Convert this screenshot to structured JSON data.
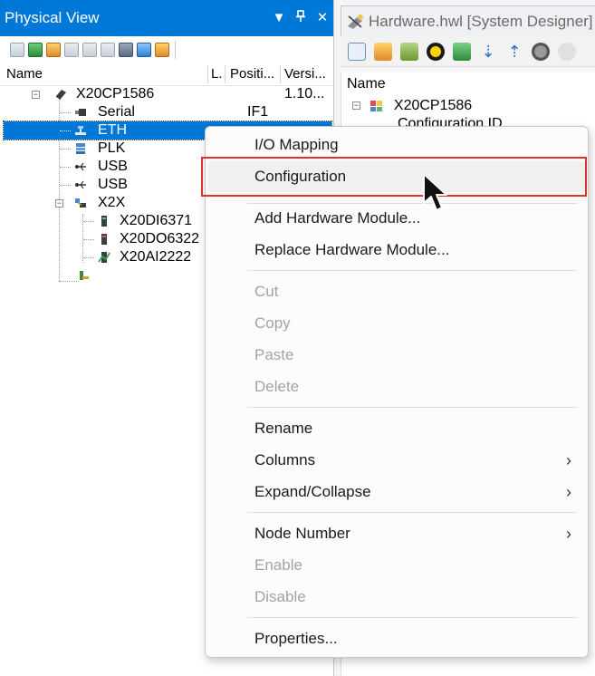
{
  "physical_view": {
    "title": "Physical View",
    "title_buttons": [
      {
        "icon": "dropdown-arrow-icon",
        "glyph": "▼"
      },
      {
        "icon": "pin-icon",
        "glyph": "⊥"
      },
      {
        "icon": "close-icon",
        "glyph": "✕"
      }
    ],
    "columns": {
      "name": "Name",
      "l": "L.",
      "position": "Positi...",
      "version": "Versi..."
    },
    "tree": [
      {
        "label": "X20CP1586",
        "icon": "cpu-icon",
        "version": "1.10...",
        "position": ""
      },
      {
        "label": "Serial",
        "icon": "serial-port-icon",
        "position": "IF1",
        "version": ""
      },
      {
        "label": "ETH",
        "icon": "ethernet-icon",
        "position": "",
        "version": "",
        "selected": true
      },
      {
        "label": "PLK",
        "icon": "powerlink-icon",
        "position": "",
        "version": ""
      },
      {
        "label": "USB",
        "icon": "usb-icon",
        "position": "",
        "version": ""
      },
      {
        "label": "USB",
        "icon": "usb-icon",
        "position": "",
        "version": ""
      },
      {
        "label": "X2X",
        "icon": "x2x-bus-icon",
        "position": "",
        "version": ""
      },
      {
        "label": "X20DI6371",
        "icon": "digital-input-module-icon",
        "position": "",
        "version": ""
      },
      {
        "label": "X20DO6322",
        "icon": "digital-output-module-icon",
        "position": "",
        "version": ""
      },
      {
        "label": "X20AI2222",
        "icon": "analog-input-module-icon",
        "position": "",
        "version": ""
      }
    ]
  },
  "hardware_tab": {
    "label": "Hardware.hwl [System Designer]",
    "icon": "hardware-config-icon",
    "header": "Name",
    "rows": [
      "X20CP1586",
      "Configuration ID"
    ]
  },
  "context_menu": {
    "items": [
      {
        "label": "I/O Mapping",
        "enabled": true
      },
      {
        "label": "Configuration",
        "enabled": true,
        "hovered": true
      },
      {
        "separator": true
      },
      {
        "label": "Add Hardware Module...",
        "enabled": true
      },
      {
        "label": "Replace Hardware Module...",
        "enabled": true
      },
      {
        "separator": true
      },
      {
        "label": "Cut",
        "enabled": false
      },
      {
        "label": "Copy",
        "enabled": false
      },
      {
        "label": "Paste",
        "enabled": false
      },
      {
        "label": "Delete",
        "enabled": false
      },
      {
        "separator": true
      },
      {
        "label": "Rename",
        "enabled": true
      },
      {
        "label": "Columns",
        "enabled": true,
        "submenu": true
      },
      {
        "label": "Expand/Collapse",
        "enabled": true,
        "submenu": true
      },
      {
        "separator": true
      },
      {
        "label": "Node Number",
        "enabled": true,
        "submenu": true
      },
      {
        "label": "Enable",
        "enabled": false
      },
      {
        "label": "Disable",
        "enabled": false
      },
      {
        "separator": true
      },
      {
        "label": "Properties...",
        "enabled": true
      }
    ]
  },
  "colors": {
    "title_bar": "#0078d7",
    "selection": "#0078d7",
    "highlight_border": "#e03030",
    "disabled_text": "#a3a3a3"
  }
}
